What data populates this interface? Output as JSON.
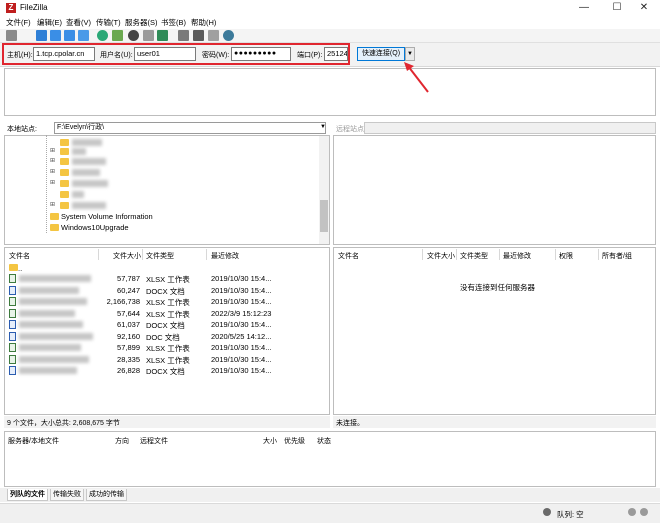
{
  "window": {
    "title": "FileZilla",
    "minimize": "—",
    "maximize": "☐",
    "close": "✕"
  },
  "menu": [
    "文件(F)",
    "编辑(E)",
    "查看(V)",
    "传输(T)",
    "服务器(S)",
    "书签(B)",
    "帮助(H)"
  ],
  "quickconnect": {
    "host_label": "主机(H):",
    "host_value": "1.tcp.cpolar.cn",
    "user_label": "用户名(U):",
    "user_value": "user01",
    "pass_label": "密码(W):",
    "pass_value": "●●●●●●●●●",
    "port_label": "端口(P):",
    "port_value": "25124",
    "connect_label": "快速连接(Q)",
    "dropdown": "▼"
  },
  "local": {
    "site_label": "本地站点:",
    "path": "F:\\Evelyn\\行政\\",
    "path_dropdown": "▼",
    "tree_items": [
      "System Volume Information",
      "Windows10Upgrade"
    ],
    "columns": [
      "文件名",
      "文件大小",
      "文件类型",
      "最近修改"
    ],
    "parent_dir": "..",
    "files": [
      {
        "size": "57,787",
        "type": "XLSX 工作表",
        "date": "2019/10/30 15:4...",
        "kind": "xlsx"
      },
      {
        "size": "60,247",
        "type": "DOCX 文档",
        "date": "2019/10/30 15:4...",
        "kind": "docx"
      },
      {
        "size": "2,166,738",
        "type": "XLSX 工作表",
        "date": "2019/10/30 15:4...",
        "kind": "xlsx"
      },
      {
        "size": "57,644",
        "type": "XLSX 工作表",
        "date": "2022/3/9 15:12:23",
        "kind": "xlsx"
      },
      {
        "size": "61,037",
        "type": "DOCX 文档",
        "date": "2019/10/30 15:4...",
        "kind": "docx"
      },
      {
        "size": "92,160",
        "type": "DOC 文档",
        "date": "2020/5/25 14:12...",
        "kind": "docx"
      },
      {
        "size": "57,899",
        "type": "XLSX 工作表",
        "date": "2019/10/30 15:4...",
        "kind": "xlsx"
      },
      {
        "size": "28,335",
        "type": "XLSX 工作表",
        "date": "2019/10/30 15:4...",
        "kind": "xlsx"
      },
      {
        "size": "26,828",
        "type": "DOCX 文档",
        "date": "2019/10/30 15:4...",
        "kind": "docx"
      }
    ],
    "status": "9 个文件，大小总共: 2,608,675 字节"
  },
  "remote": {
    "site_label": "远程站点:",
    "columns": [
      "文件名",
      "文件大小",
      "文件类型",
      "最近修改",
      "权限",
      "所有者/组"
    ],
    "empty_message": "没有连接到任何服务器",
    "status": "未连接。"
  },
  "queue": {
    "columns": [
      "服务器/本地文件",
      "方向",
      "远程文件",
      "大小",
      "优先级",
      "状态"
    ],
    "tabs": [
      "列队的文件",
      "传输失败",
      "成功的传输"
    ],
    "status": "队列: 空"
  },
  "colors": {
    "highlight": "#e0262f",
    "connect_border": "#0078d7",
    "folder": "#f4c542"
  }
}
